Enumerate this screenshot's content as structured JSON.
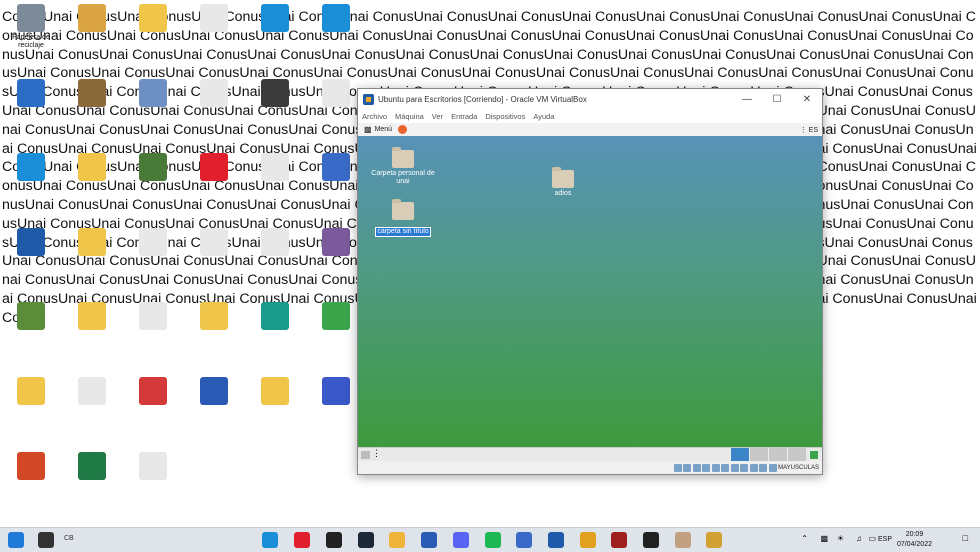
{
  "wallpaper": {
    "text": "ConusUnai ConusUnai ConusUnai ConusUnai ConusUnai ConusUnai ConusUnai ConusUnai ConusUnai ConusUnai ConusUnai ConusUnai ConusUnai ConusUnai ConusUnai ConusUnai ConusUnai ConusUnai ConusUnai ConusUnai ConusUnai ConusUnai ConusUnai ConusUnai ConusUnai ConusUnai ConusUnai ConusUnai ConusUnai ConusUnai ConusUnai ConusUnai ConusUnai ConusUnai ConusUnai ConusUnai ConusUnai ConusUnai ConusUnai ConusUnai ConusUnai ConusUnai ConusUnai ConusUnai ConusUnai ConusUnai ConusUnai ConusUnai ConusUnai ConusUnai ConusUnai ConusUnai ConusUnai ConusUnai ConusUnai ConusUnai ConusUnai ConusUnai ConusUnai ConusUnai ConusUnai ConusUnai ConusUnai ConusUnai ConusUnai ConusUnai ConusUnai ConusUnai ConusUnai ConusUnai ConusUnai ConusUnai ConusUnai ConusUnai ConusUnai ConusUnai ConusUnai ConusUnai ConusUnai ConusUnai ConusUnai ConusUnai ConusUnai ConusUnai ConusUnai ConusUnai ConusUnai ConusUnai ConusUnai ConusUnai ConusUnai ConusUnai ConusUnai ConusUnai ConusUnai ConusUnai ConusUnai ConusUnai ConusUnai ConusUnai ConusUnai ConusUnai ConusUnai ConusUnai ConusUnai ConusUnai ConusUnai ConusUnai ConusUnai ConusUnai ConusUnai ConusUnai ConusUnai ConusUnai ConusUnai ConusUnai ConusUnai ConusUnai ConusUnai ConusUnai ConusUnai ConusUnai ConusUnai ConusUnai ConusUnai ConusUnai ConusUnai ConusUnai ConusUnai ConusUnai ConusUnai ConusUnai ConusUnai ConusUnai ConusUnai ConusUnai ConusUnai ConusUnai ConusUnai ConusUnai ConusUnai ConusUnai ConusUnai ConusUnai ConusUnai ConusUnai ConusUnai ConusUnai ConusUnai ConusUnai ConusUnai ConusUnai ConusUnai ConusUnai ConusUnai ConusUnai ConusUnai ConusUnai ConusUnai ConusUnai ConusUnai ConusUnai ConusUnai ConusUnai ConusUnai ConusUnai ConusUnai ConusUnai ConusUnai ConusUnai ConusUnai ConusUnai ConusUnai ConusUnai ConusUnai ConusUnai ConusUnai ConusUnai ConusUnai ConusUnai ConusUnai ConusUnai ConusUnai ConusUnai ConusUnai ConusUnai ConusUnai ConusUnai ConusUnai ConusUnai ConusUnai ConusUnai ConusUnai ConusUnai ConusUnai ConusUnai ConusUnai ConusUnai ConusUnai ConusUnai ConusUnai ConusUnai ConusUnai ConusUnai ConusUnai ConusUnai ConusUnai ConusUnai ConusUnai ConusUnai Conus"
  },
  "desktop_icons": [
    {
      "label": "Papelera de reciclaje",
      "icon": "recycle-bin-icon",
      "color": "#7d8a99"
    },
    {
      "label": "",
      "icon": "app-icon",
      "color": "#d9a441"
    },
    {
      "label": "",
      "icon": "folder-icon",
      "color": "#f0c64a"
    },
    {
      "label": "",
      "icon": "file-icon",
      "color": "#e8e8e8"
    },
    {
      "label": "",
      "icon": "edge-icon",
      "color": "#1a8fd8"
    },
    {
      "label": "",
      "icon": "edge-icon",
      "color": "#1a8fd8"
    },
    {
      "label": "",
      "icon": "app-icon",
      "color": "#2b6cc4"
    },
    {
      "label": "",
      "icon": "app-icon",
      "color": "#8a6a3a"
    },
    {
      "label": "",
      "icon": "app-icon",
      "color": "#6e8fc4"
    },
    {
      "label": "",
      "icon": "file-icon",
      "color": "#e8e8e8"
    },
    {
      "label": "",
      "icon": "app-icon",
      "color": "#3b3b3b"
    },
    {
      "label": "",
      "icon": "file-icon",
      "color": "#e8e8e8"
    },
    {
      "label": "",
      "icon": "edge-icon",
      "color": "#1a8fd8"
    },
    {
      "label": "",
      "icon": "folder-icon",
      "color": "#f0c64a"
    },
    {
      "label": "",
      "icon": "app-icon",
      "color": "#4a7a3a"
    },
    {
      "label": "",
      "icon": "opera-icon",
      "color": "#e0202c"
    },
    {
      "label": "",
      "icon": "file-icon",
      "color": "#e8e8e8"
    },
    {
      "label": "",
      "icon": "app-icon",
      "color": "#3a6ac8"
    },
    {
      "label": "",
      "icon": "virtualbox-icon",
      "color": "#1e5aa8"
    },
    {
      "label": "",
      "icon": "folder-icon",
      "color": "#f0c64a"
    },
    {
      "label": "",
      "icon": "file-icon",
      "color": "#e8e8e8"
    },
    {
      "label": "",
      "icon": "file-icon",
      "color": "#e8e8e8"
    },
    {
      "label": "",
      "icon": "file-icon",
      "color": "#e8e8e8"
    },
    {
      "label": "",
      "icon": "app-icon",
      "color": "#7a5a9a"
    },
    {
      "label": "",
      "icon": "minecraft-icon",
      "color": "#5b8c3a"
    },
    {
      "label": "",
      "icon": "folder-icon",
      "color": "#f0c64a"
    },
    {
      "label": "",
      "icon": "file-icon",
      "color": "#e8e8e8"
    },
    {
      "label": "",
      "icon": "folder-icon",
      "color": "#f0c64a"
    },
    {
      "label": "",
      "icon": "filmora-icon",
      "color": "#1a9a8a"
    },
    {
      "label": "",
      "icon": "app-icon",
      "color": "#3aa54a"
    },
    {
      "label": "",
      "icon": "folder-icon",
      "color": "#f0c64a"
    },
    {
      "label": "",
      "icon": "file-icon",
      "color": "#e8e8e8"
    },
    {
      "label": "",
      "icon": "app-icon",
      "color": "#d43a3a"
    },
    {
      "label": "",
      "icon": "word-icon",
      "color": "#2b5ab4"
    },
    {
      "label": "",
      "icon": "folder-icon",
      "color": "#f0c64a"
    },
    {
      "label": "",
      "icon": "app-icon",
      "color": "#3a58c8"
    },
    {
      "label": "",
      "icon": "powerpoint-icon",
      "color": "#d24726"
    },
    {
      "label": "",
      "icon": "excel-icon",
      "color": "#1f7a45"
    },
    {
      "label": "",
      "icon": "file-icon",
      "color": "#e8e8e8"
    }
  ],
  "vbox": {
    "title": "Ubuntu para Escritorios [Corriendo] - Oracle VM VirtualBox",
    "menu": [
      "Archivo",
      "Máquina",
      "Ver",
      "Entrada",
      "Dispositivos",
      "Ayuda"
    ],
    "guest_panel": {
      "menu_label": "Menú",
      "lang": "ES"
    },
    "guest_icons": [
      {
        "label": "Carpeta personal de unai",
        "selected": false
      },
      {
        "label": "adios",
        "selected": false
      },
      {
        "label": "carpeta sin título",
        "selected": true
      }
    ],
    "status_text": "MAYUSCULAS"
  },
  "taskbar": {
    "search_text": "CB",
    "lang": "ESP",
    "time": "20:09",
    "date": "07/04/2022",
    "apps": [
      {
        "icon": "windows-start-icon",
        "color": "#1f7ad8"
      },
      {
        "icon": "search-icon",
        "color": "#333333"
      },
      {
        "icon": "task-view-icon",
        "color": "#555555"
      },
      {
        "icon": "edge-icon",
        "color": "#1a8fd8"
      },
      {
        "icon": "opera-icon",
        "color": "#e0202c"
      },
      {
        "icon": "unity-icon",
        "color": "#222222"
      },
      {
        "icon": "steam-icon",
        "color": "#1b2838"
      },
      {
        "icon": "file-explorer-icon",
        "color": "#f0b43a"
      },
      {
        "icon": "word-icon",
        "color": "#2b5ab4"
      },
      {
        "icon": "discord-icon",
        "color": "#5865f2"
      },
      {
        "icon": "spotify-icon",
        "color": "#1db954"
      },
      {
        "icon": "app-icon",
        "color": "#3a6ac8"
      },
      {
        "icon": "virtualbox-icon",
        "color": "#1e5aa8"
      },
      {
        "icon": "chrome-icon",
        "color": "#e0a020"
      },
      {
        "icon": "app-icon",
        "color": "#a02020"
      },
      {
        "icon": "epic-games-icon",
        "color": "#222222"
      },
      {
        "icon": "app-icon",
        "color": "#c0a080"
      },
      {
        "icon": "app-icon",
        "color": "#d0a030"
      }
    ]
  }
}
